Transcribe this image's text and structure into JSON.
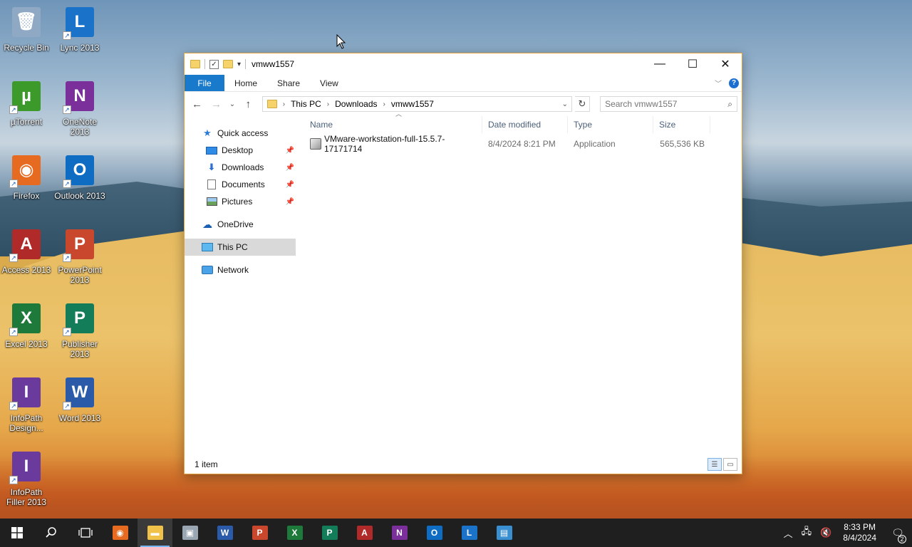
{
  "desktop": {
    "icons": [
      {
        "label": "Recycle Bin",
        "letter": "🗑",
        "color": "#8fa8c4"
      },
      {
        "label": "Lync 2013",
        "letter": "L",
        "color": "#1a73c9"
      },
      {
        "label": "µTorrent",
        "letter": "µ",
        "color": "#3b9a2a"
      },
      {
        "label": "OneNote 2013",
        "letter": "N",
        "color": "#7a2f9b"
      },
      {
        "label": "Firefox",
        "letter": "◉",
        "color": "#e66a1f"
      },
      {
        "label": "Outlook 2013",
        "letter": "O",
        "color": "#0e6cc2"
      },
      {
        "label": "Access 2013",
        "letter": "A",
        "color": "#b02a2a"
      },
      {
        "label": "PowerPoint 2013",
        "letter": "P",
        "color": "#c9472c"
      },
      {
        "label": "Excel 2013",
        "letter": "X",
        "color": "#1e7a3a"
      },
      {
        "label": "Publisher 2013",
        "letter": "P",
        "color": "#137d5a"
      },
      {
        "label": "InfoPath Design...",
        "letter": "I",
        "color": "#6a3a9c"
      },
      {
        "label": "Word 2013",
        "letter": "W",
        "color": "#2a5aa8"
      },
      {
        "label": "InfoPath Filler 2013",
        "letter": "I",
        "color": "#6a3a9c"
      }
    ]
  },
  "window": {
    "title": "vmww1557",
    "controls": {
      "minimize": "—",
      "maximize": "☐",
      "close": "✕"
    },
    "ribbon": {
      "tabs": [
        "File",
        "Home",
        "Share",
        "View"
      ],
      "help": "?"
    },
    "address": {
      "crumbs": [
        "This PC",
        "Downloads",
        "vmww1557"
      ]
    },
    "search": {
      "placeholder": "Search vmww1557"
    },
    "nav": {
      "quick_access": "Quick access",
      "pinned": [
        "Desktop",
        "Downloads",
        "Documents",
        "Pictures"
      ],
      "onedrive": "OneDrive",
      "this_pc": "This PC",
      "network": "Network"
    },
    "columns": {
      "name": "Name",
      "date": "Date modified",
      "type": "Type",
      "size": "Size"
    },
    "files": [
      {
        "name": "VMware-workstation-full-15.5.7-17171714",
        "date": "8/4/2024 8:21 PM",
        "type": "Application",
        "size": "565,536 KB"
      }
    ],
    "status": "1 item"
  },
  "taskbar": {
    "apps": [
      {
        "name": "firefox",
        "letter": "◉",
        "color": "#e66a1f"
      },
      {
        "name": "file-explorer",
        "letter": "▬",
        "color": "#f0c24a"
      },
      {
        "name": "photos",
        "letter": "▣",
        "color": "#9aa6b2"
      },
      {
        "name": "word",
        "letter": "W",
        "color": "#2a5aa8"
      },
      {
        "name": "powerpoint",
        "letter": "P",
        "color": "#c9472c"
      },
      {
        "name": "excel",
        "letter": "X",
        "color": "#1e7a3a"
      },
      {
        "name": "publisher",
        "letter": "P",
        "color": "#137d5a"
      },
      {
        "name": "access",
        "letter": "A",
        "color": "#b02a2a"
      },
      {
        "name": "onenote",
        "letter": "N",
        "color": "#7a2f9b"
      },
      {
        "name": "outlook",
        "letter": "O",
        "color": "#0e6cc2"
      },
      {
        "name": "lync",
        "letter": "L",
        "color": "#1a73c9"
      },
      {
        "name": "remote-app",
        "letter": "▤",
        "color": "#3a8fd0"
      }
    ],
    "time": "8:33 PM",
    "date": "8/4/2024",
    "notifications": "2"
  }
}
